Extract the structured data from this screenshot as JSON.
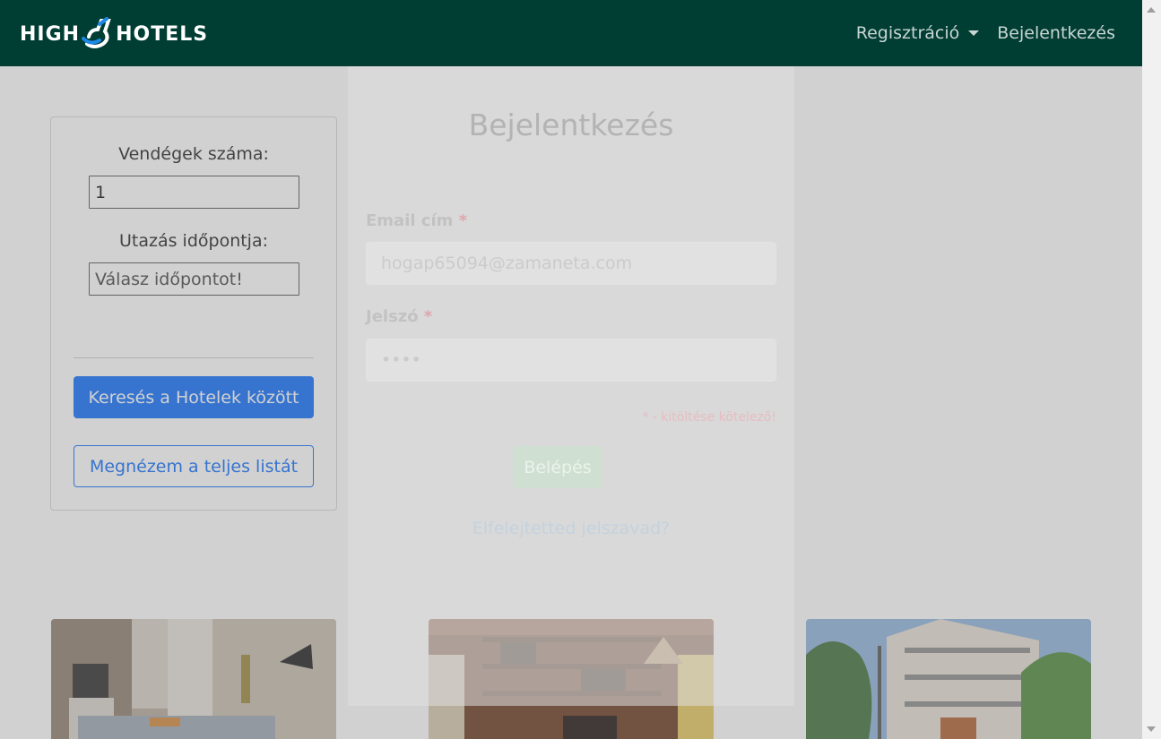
{
  "navbar": {
    "brand_left": "HIGH",
    "brand_right": "HOTELS",
    "register_label": "Regisztráció",
    "login_label": "Bejelentkezés"
  },
  "search": {
    "guests_label": "Vendégek száma:",
    "guests_value": "1",
    "date_label": "Utazás időpontja:",
    "date_placeholder": "Válasz időpontot!",
    "search_button": "Keresés a Hotelek között",
    "full_list_button": "Megnézem a teljes listát"
  },
  "hotels": [
    {
      "icon": "hotel-room-photo"
    },
    {
      "icon": "hotel-lounge-photo"
    },
    {
      "icon": "hotel-building-photo"
    }
  ],
  "modal": {
    "title": "Bejelentkezés",
    "email_label": "Email cím",
    "email_value": "hogap65094@zamaneta.com",
    "password_label": "Jelszó",
    "password_value": "••••",
    "required_mark": "*",
    "required_note": "* - kitöltése kötelező!",
    "login_button": "Belépés",
    "forgot_link": "Elfelejtetted jelszavad?"
  },
  "colors": {
    "navbar": "#003d33",
    "primary": "#0d6efd",
    "login_button": "#198754"
  }
}
